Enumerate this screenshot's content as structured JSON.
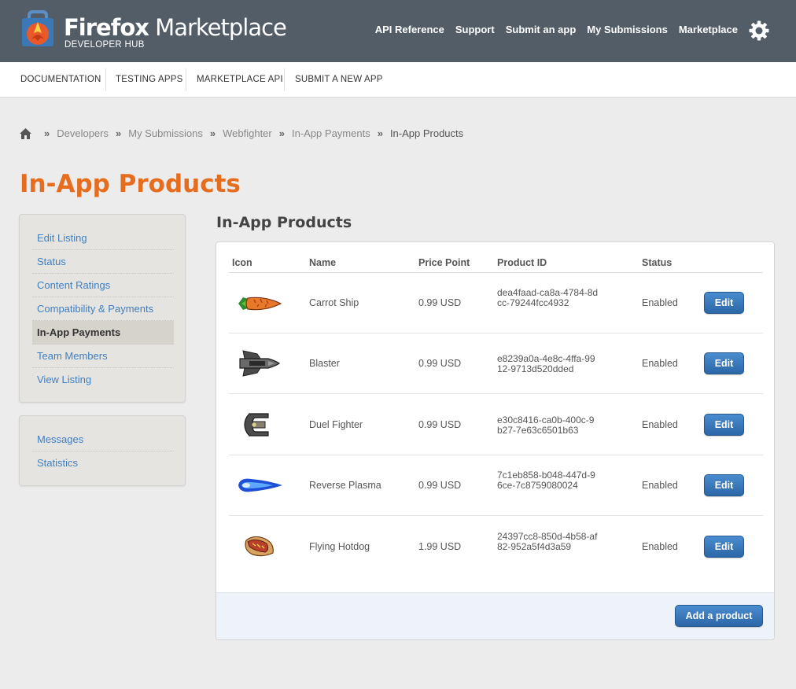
{
  "header": {
    "brand_bold": "Firefox",
    "brand_rest": " Marketplace",
    "subtitle": "DEVELOPER HUB",
    "nav": [
      "API Reference",
      "Support",
      "Submit an app",
      "My Submissions",
      "Marketplace"
    ],
    "settings_icon": "gear-icon"
  },
  "subnav": [
    "DOCUMENTATION",
    "TESTING APPS",
    "MARKETPLACE API",
    "SUBMIT A NEW APP"
  ],
  "breadcrumb": {
    "home_icon": "home-icon",
    "items": [
      "Developers",
      "My Submissions",
      "Webfighter",
      "In-App Payments"
    ],
    "current": "In-App Products",
    "separator": "»"
  },
  "page_title": "In-App Products",
  "sidebar": {
    "primary": [
      "Edit Listing",
      "Status",
      "Content Ratings",
      "Compatibility & Payments",
      "In-App Payments",
      "Team Members",
      "View Listing"
    ],
    "active": "In-App Payments",
    "secondary": [
      "Messages",
      "Statistics"
    ]
  },
  "main": {
    "section_title": "In-App Products",
    "columns": [
      "Icon",
      "Name",
      "Price Point",
      "Product ID",
      "Status"
    ],
    "products": [
      {
        "icon": "carrot-ship-icon",
        "name": "Carrot Ship",
        "price": "0.99 USD",
        "id": "dea4faad-ca8a-4784-8dcc-79244fcc4932",
        "status": "Enabled",
        "action": "Edit"
      },
      {
        "icon": "blaster-ship-icon",
        "name": "Blaster",
        "price": "0.99 USD",
        "id": "e8239a0a-4e8c-4ffa-9912-9713d520dded",
        "status": "Enabled",
        "action": "Edit"
      },
      {
        "icon": "duel-fighter-icon",
        "name": "Duel Fighter",
        "price": "0.99 USD",
        "id": "e30c8416-ca0b-400c-9b27-7e63c6501b63",
        "status": "Enabled",
        "action": "Edit"
      },
      {
        "icon": "reverse-plasma-icon",
        "name": "Reverse Plasma",
        "price": "0.99 USD",
        "id": "7c1eb858-b048-447d-96ce-7c8759080024",
        "status": "Enabled",
        "action": "Edit"
      },
      {
        "icon": "flying-hotdog-icon",
        "name": "Flying Hotdog",
        "price": "1.99 USD",
        "id": "24397cc8-850d-4b58-af82-952a5f4d3a59",
        "status": "Enabled",
        "action": "Edit"
      }
    ],
    "add_button": "Add a product"
  },
  "colors": {
    "header_bg": "#525d68",
    "title_orange": "#e76d1e",
    "link_blue": "#3f7fc0",
    "button_blue": "#2c67a8"
  }
}
